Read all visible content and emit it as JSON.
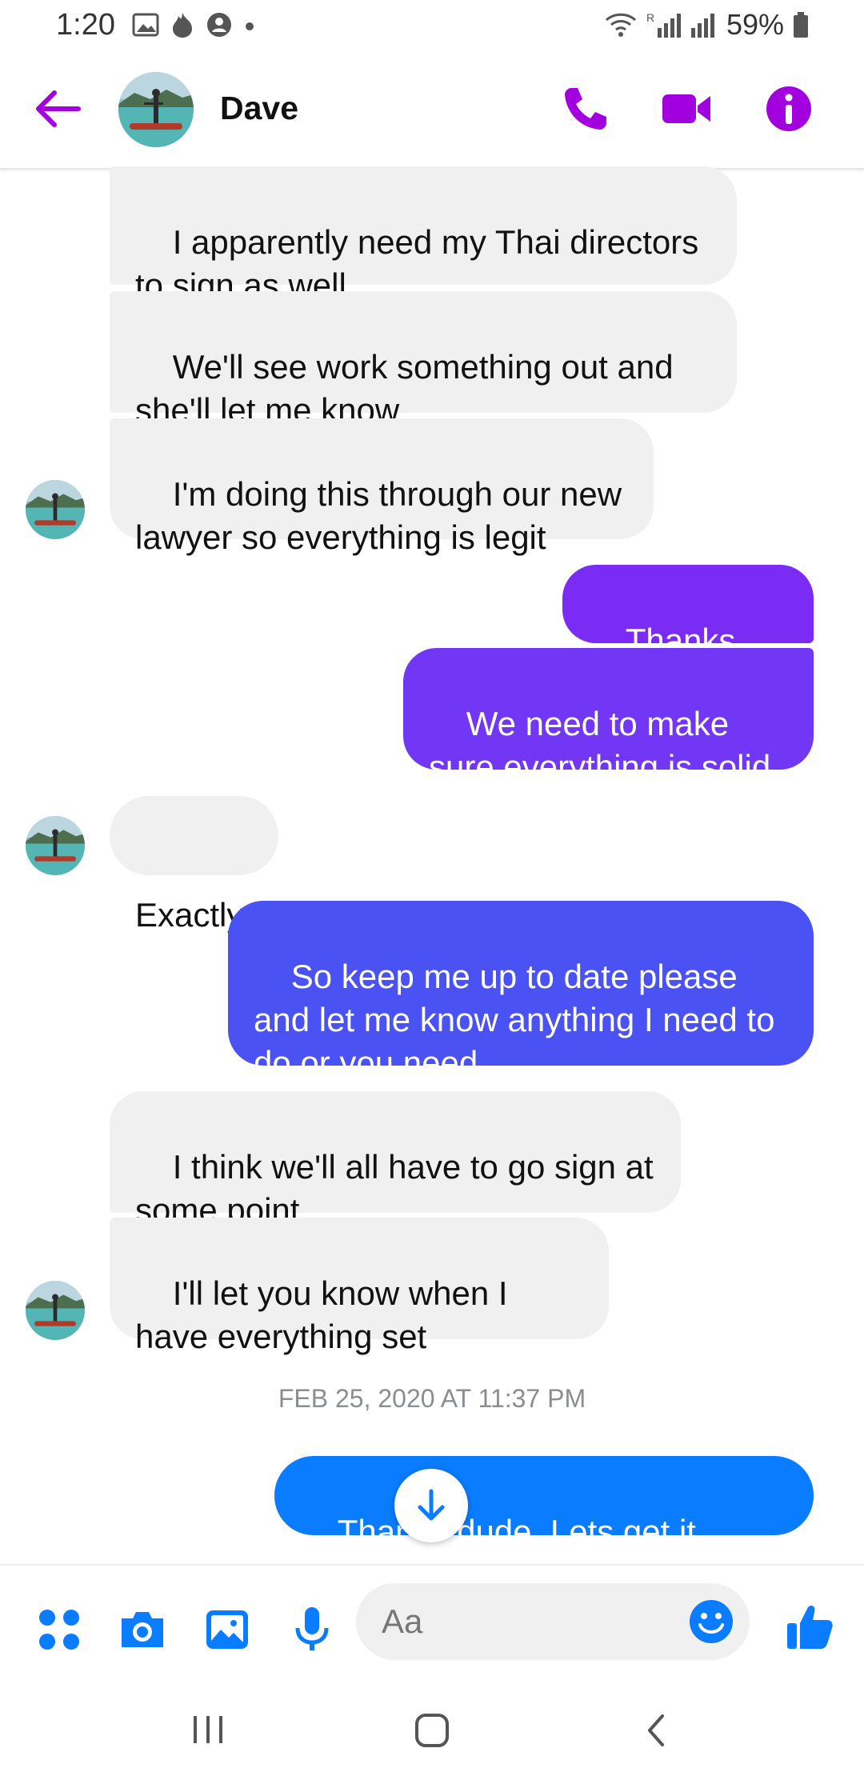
{
  "status_bar": {
    "time": "1:20",
    "battery": "59%",
    "icons": [
      "image-icon",
      "flame-icon",
      "account-icon",
      "dot-icon",
      "wifi-icon",
      "signal-icon",
      "signal-icon",
      "battery-icon"
    ]
  },
  "header": {
    "contact_name": "Dave",
    "icons": [
      "back-arrow-icon",
      "phone-icon",
      "video-camera-icon",
      "info-icon"
    ]
  },
  "colors": {
    "accent": "#a300e0",
    "outgoing_purple": "#7a2cf5",
    "outgoing_indigo": "#4a52f3",
    "outgoing_blue": "#0a7cff",
    "incoming_bg": "#f0f0f0"
  },
  "messages": [
    {
      "direction": "in",
      "text": "I apparently need my Thai directors to sign as well"
    },
    {
      "direction": "in",
      "text": "We'll see work something out and she'll let me know"
    },
    {
      "direction": "in",
      "text": "I'm doing this through our new lawyer so everything is legit"
    },
    {
      "direction": "out",
      "text": "Thanks man"
    },
    {
      "direction": "out",
      "text": "We need to make sure everything is solid"
    },
    {
      "direction": "in",
      "text": "Exactly"
    },
    {
      "direction": "out",
      "text": "So keep me up to date please and let me know anything I need to do or you need"
    },
    {
      "direction": "in",
      "text": "I think we'll all have to go sign at some point"
    },
    {
      "direction": "in",
      "text": "I'll let you know when I have everything set"
    },
    {
      "direction": "out",
      "text": "Thanks dude. Lets get it done!"
    }
  ],
  "timestamp": "FEB 25, 2020 AT 11:37 PM",
  "composer": {
    "placeholder": "Aa",
    "icons": [
      "apps-icon",
      "camera-icon",
      "gallery-icon",
      "microphone-icon",
      "emoji-icon",
      "thumbs-up-icon"
    ]
  },
  "scroll_down_icon": "arrow-down-icon",
  "nav_bar": {
    "icons": [
      "recent-apps-icon",
      "home-icon",
      "back-icon"
    ]
  }
}
